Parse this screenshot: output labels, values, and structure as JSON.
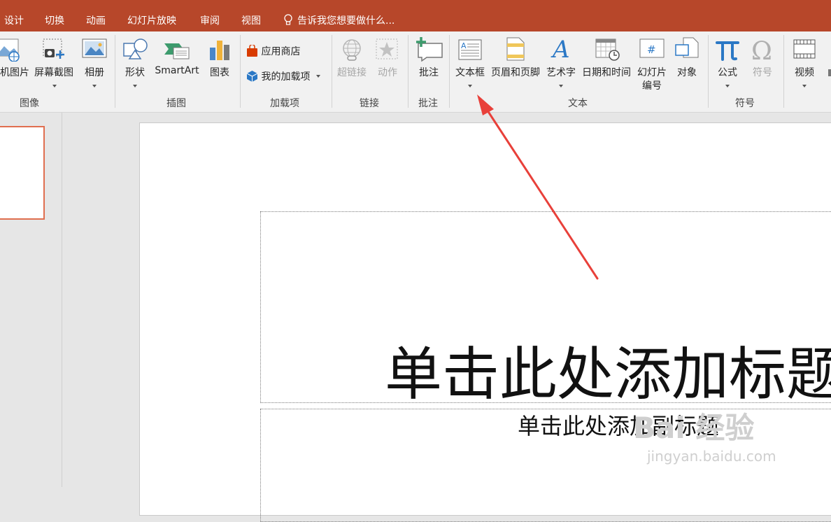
{
  "tabs": {
    "design": "设计",
    "transitions": "切换",
    "animations": "动画",
    "slideshow": "幻灯片放映",
    "review": "审阅",
    "view": "视图"
  },
  "tell_me": "告诉我您想要做什么...",
  "ribbon": {
    "images": {
      "online_pictures": "机图片",
      "screenshot": "屏幕截图",
      "photo_album": "相册",
      "group_label": "图像"
    },
    "illustrations": {
      "shapes": "形状",
      "smartart": "SmartArt",
      "chart": "图表",
      "group_label": "插图"
    },
    "addins": {
      "store": "应用商店",
      "my_addins": "我的加载项",
      "group_label": "加载项"
    },
    "links": {
      "hyperlink": "超链接",
      "action": "动作",
      "group_label": "链接"
    },
    "comments": {
      "comment": "批注",
      "group_label": "批注"
    },
    "text": {
      "textbox": "文本框",
      "header_footer": "页眉和页脚",
      "wordart": "艺术字",
      "date_time": "日期和时间",
      "slide_number_line1": "幻灯片",
      "slide_number_line2": "编号",
      "object": "对象",
      "group_label": "文本"
    },
    "symbols": {
      "equation": "公式",
      "symbol": "符号",
      "group_label": "符号"
    },
    "media": {
      "video": "视频"
    }
  },
  "slide": {
    "title_placeholder": "单击此处添加标题",
    "subtitle_placeholder": "单击此处添加副标题"
  },
  "watermark": {
    "brand": "Bai 经验",
    "url": "jingyan.baidu.com"
  },
  "colors": {
    "tab_bar": "#b7472a",
    "annotation_arrow": "#e8403a",
    "thumbnail_border": "#e06e4f"
  }
}
